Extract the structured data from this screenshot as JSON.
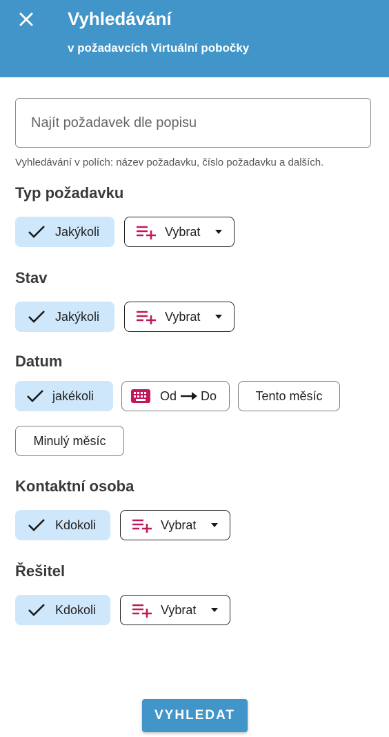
{
  "header": {
    "title": "Vyhledávání",
    "subtitle": "v požadavcích Virtuální pobočky"
  },
  "search": {
    "placeholder": "Najít požadavek dle popisu",
    "hint": "Vyhledávání v polích: název požadavku, číslo požadavku a dalších."
  },
  "sections": {
    "type": {
      "title": "Typ požadavku",
      "any_label": "Jakýkoli",
      "select_label": "Vybrat"
    },
    "state": {
      "title": "Stav",
      "any_label": "Jakýkoli",
      "select_label": "Vybrat"
    },
    "date": {
      "title": "Datum",
      "any_label": "jakékoli",
      "range_from": "Od",
      "range_to": "Do",
      "this_month": "Tento měsíc",
      "last_month": "Minulý měsíc"
    },
    "contact": {
      "title": "Kontaktní osoba",
      "any_label": "Kdokoli",
      "select_label": "Vybrat"
    },
    "solver": {
      "title": "Řešitel",
      "any_label": "Kdokoli",
      "select_label": "Vybrat"
    }
  },
  "footer": {
    "search_button": "VYHLEDAT"
  },
  "colors": {
    "primary": "#4195c8",
    "chip_selected": "#cfe7fb",
    "accent_icon": "#c2185b"
  },
  "icons": [
    "close-icon",
    "check-icon",
    "playlist-add-icon",
    "dropdown-arrow-icon",
    "keyboard-icon",
    "arrow-right-icon"
  ]
}
